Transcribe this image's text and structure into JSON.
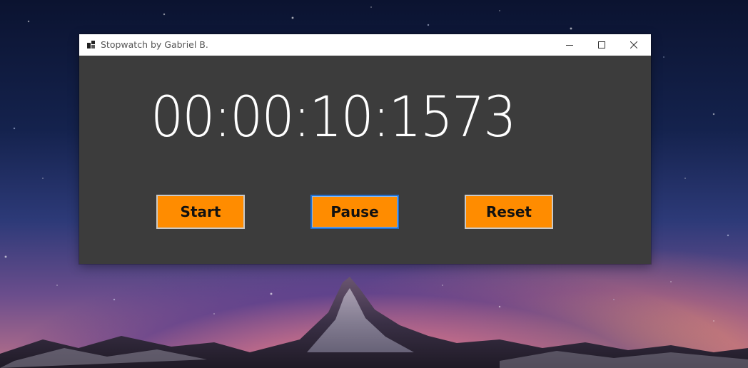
{
  "window": {
    "title": "Stopwatch by Gabriel B.",
    "controls": {
      "minimize_icon": "minimize-icon",
      "maximize_icon": "maximize-icon",
      "close_icon": "close-icon"
    }
  },
  "stopwatch": {
    "time": "00:00:10:1573"
  },
  "buttons": {
    "start_label": "Start",
    "pause_label": "Pause",
    "reset_label": "Reset"
  },
  "colors": {
    "window_background": "#3c3c3c",
    "titlebar_background": "#ffffff",
    "button_background": "#ff8c00",
    "time_text": "#ffffff",
    "focused_border": "#1f6fd0"
  },
  "desktop": {
    "wallpaper": "night-sky-mountain"
  }
}
